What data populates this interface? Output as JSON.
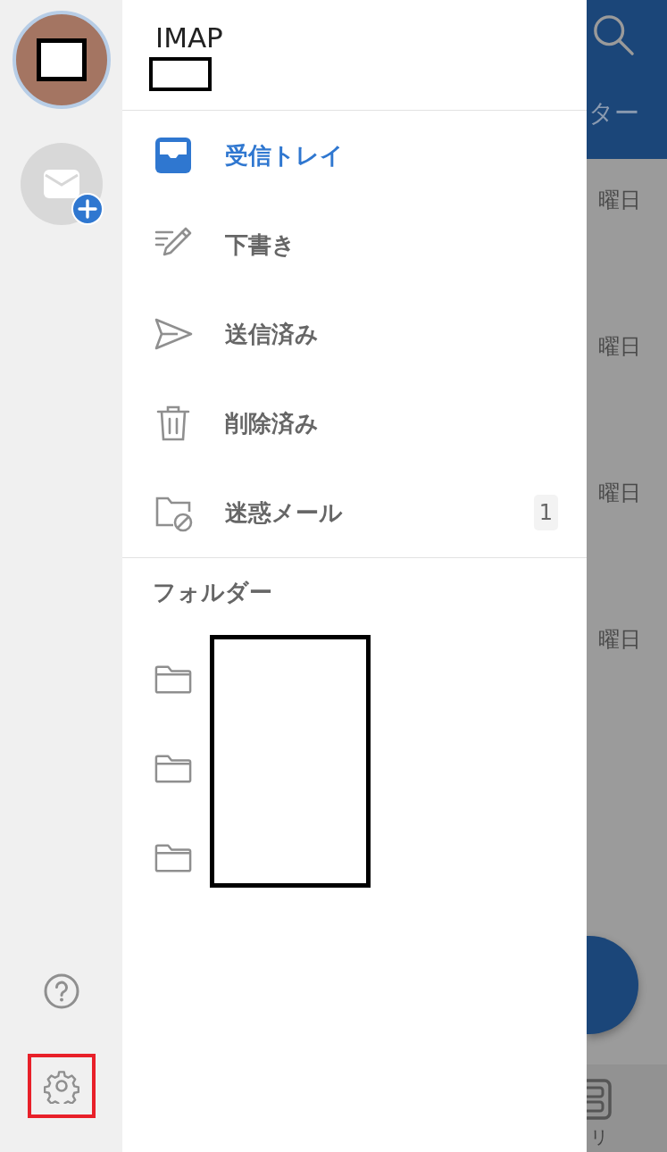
{
  "rail": {
    "accounts": [
      {
        "kind": "avatar",
        "selected": true
      },
      {
        "kind": "add-account",
        "selected": false
      }
    ],
    "bottom": [
      {
        "kind": "help"
      },
      {
        "kind": "settings",
        "highlighted": true
      }
    ]
  },
  "drawer": {
    "account_type": "IMAP",
    "account_redacted": true,
    "mail_folders": [
      {
        "kind": "inbox",
        "label": "受信トレイ",
        "selected": true
      },
      {
        "kind": "drafts",
        "label": "下書き",
        "selected": false
      },
      {
        "kind": "sent",
        "label": "送信済み",
        "selected": false
      },
      {
        "kind": "deleted",
        "label": "削除済み",
        "selected": false
      },
      {
        "kind": "junk",
        "label": "迷惑メール",
        "selected": false,
        "badge": "1"
      }
    ],
    "section_title": "フォルダー",
    "custom_folders": [
      {
        "kind": "folder"
      },
      {
        "kind": "folder"
      },
      {
        "kind": "folder"
      }
    ],
    "custom_folders_redacted": true
  },
  "background": {
    "header_text": "ター",
    "dates": [
      "曜日",
      "曜日",
      "曜日",
      "曜日"
    ],
    "tab_label": "リ"
  }
}
